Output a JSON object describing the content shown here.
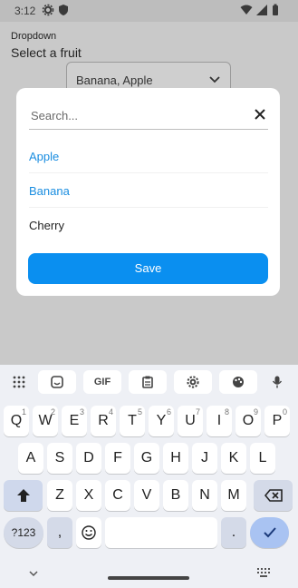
{
  "status_bar": {
    "time": "3:12"
  },
  "app": {
    "title": "Dropdown",
    "label": "Select a fruit",
    "dropdown_value": "Banana, Apple"
  },
  "modal": {
    "search_placeholder": "Search...",
    "options": [
      {
        "label": "Apple",
        "selected": true
      },
      {
        "label": "Banana",
        "selected": true
      },
      {
        "label": "Cherry",
        "selected": false
      }
    ],
    "save_label": "Save"
  },
  "keyboard": {
    "toolbar": {
      "gif_label": "GIF"
    },
    "row1": [
      {
        "k": "Q",
        "n": "1"
      },
      {
        "k": "W",
        "n": "2"
      },
      {
        "k": "E",
        "n": "3"
      },
      {
        "k": "R",
        "n": "4"
      },
      {
        "k": "T",
        "n": "5"
      },
      {
        "k": "Y",
        "n": "6"
      },
      {
        "k": "U",
        "n": "7"
      },
      {
        "k": "I",
        "n": "8"
      },
      {
        "k": "O",
        "n": "9"
      },
      {
        "k": "P",
        "n": "0"
      }
    ],
    "row2": [
      "A",
      "S",
      "D",
      "F",
      "G",
      "H",
      "J",
      "K",
      "L"
    ],
    "row3": [
      "Z",
      "X",
      "C",
      "V",
      "B",
      "N",
      "M"
    ],
    "row4": {
      "num_label": "?123",
      "comma": ",",
      "period": "."
    }
  },
  "colors": {
    "accent": "#0a8ff0",
    "selected_option": "#1a8de0"
  }
}
